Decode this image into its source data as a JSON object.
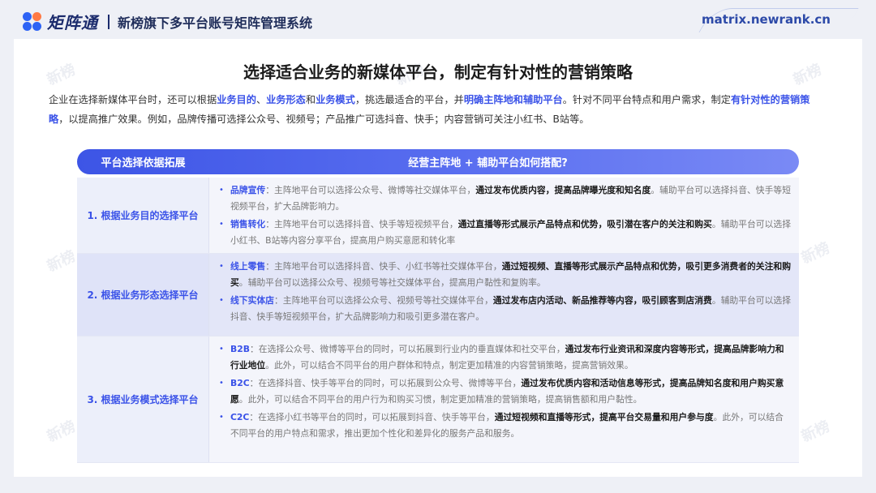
{
  "header": {
    "logo_text": "矩阵通",
    "system_title": "新榜旗下多平台账号矩阵管理系统",
    "site_url": "matrix.newrank.cn"
  },
  "watermark": "新榜",
  "main": {
    "title": "选择适合业务的新媒体平台，制定有针对性的营销策略",
    "intro": [
      {
        "t": "企业在选择新媒体平台时，还可以根据",
        "h": false
      },
      {
        "t": "业务目的",
        "h": true
      },
      {
        "t": "、",
        "h": false
      },
      {
        "t": "业务形态",
        "h": true
      },
      {
        "t": "和",
        "h": false
      },
      {
        "t": "业务模式",
        "h": true
      },
      {
        "t": "，挑选最适合的平台，并",
        "h": false
      },
      {
        "t": "明确主阵地和辅助平台",
        "h": true
      },
      {
        "t": "。针对不同平台特点和用户需求，制定",
        "h": false
      },
      {
        "t": "有针对性的营销策略",
        "h": true
      },
      {
        "t": "，以提高推广效果。例如，品牌传播可选择公众号、视频号；产品推广可选抖音、快手；内容营销可关注小红书、B站等。",
        "h": false
      }
    ]
  },
  "table": {
    "head_left": "平台选择依据拓展",
    "head_right": "经营主阵地 + 辅助平台如何搭配?",
    "rows": [
      {
        "label": "1. 根据业务目的选择平台",
        "items": [
          {
            "label": "品牌宣传",
            "pre": "：主阵地平台可以选择公众号、微博等社交媒体平台，",
            "strong": "通过发布优质内容，提高品牌曝光度和知名度",
            "post": "。辅助平台可以选择抖音、快手等短视频平台，扩大品牌影响力。"
          },
          {
            "label": "销售转化",
            "pre": "：主阵地平台可以选择抖音、快手等短视频平台，",
            "strong": "通过直播等形式展示产品特点和优势，吸引潜在客户的关注和购买",
            "post": "。辅助平台可以选择小红书、B站等内容分享平台，提高用户购买意愿和转化率"
          }
        ]
      },
      {
        "label": "2. 根据业务形态选择平台",
        "items": [
          {
            "label": "线上零售",
            "pre": "：主阵地平台可以选择抖音、快手、小红书等社交媒体平台，",
            "strong": "通过短视频、直播等形式展示产品特点和优势，吸引更多消费者的关注和购买",
            "post": "。辅助平台可以选择公众号、视频号等社交媒体平台，提高用户黏性和复购率。"
          },
          {
            "label": "线下实体店",
            "pre": "：主阵地平台可以选择公众号、视频号等社交媒体平台，",
            "strong": "通过发布店内活动、新品推荐等内容，吸引顾客到店消费",
            "post": "。辅助平台可以选择抖音、快手等短视频平台，扩大品牌影响力和吸引更多潜在客户。"
          }
        ]
      },
      {
        "label": "3. 根据业务模式选择平台",
        "items": [
          {
            "label": "B2B",
            "pre": "：在选择公众号、微博等平台的同时，可以拓展到行业内的垂直媒体和社交平台，",
            "strong": "通过发布行业资讯和深度内容等形式，提高品牌影响力和行业地位",
            "post": "。此外，可以结合不同平台的用户群体和特点，制定更加精准的内容营销策略，提高营销效果。"
          },
          {
            "label": "B2C",
            "pre": "：在选择抖音、快手等平台的同时，可以拓展到公众号、微博等平台，",
            "strong": "通过发布优质内容和活动信息等形式，提高品牌知名度和用户购买意愿",
            "post": "。此外，可以结合不同平台的用户行为和购买习惯，制定更加精准的营销策略，提高销售额和用户黏性。"
          },
          {
            "label": "C2C",
            "pre": "：在选择小红书等平台的同时，可以拓展到抖音、快手等平台，",
            "strong": "通过短视频和直播等形式，提高平台交易量和用户参与度",
            "post": "。此外，可以结合不同平台的用户特点和需求，推出更加个性化和差异化的服务产品和服务。"
          }
        ]
      }
    ]
  }
}
